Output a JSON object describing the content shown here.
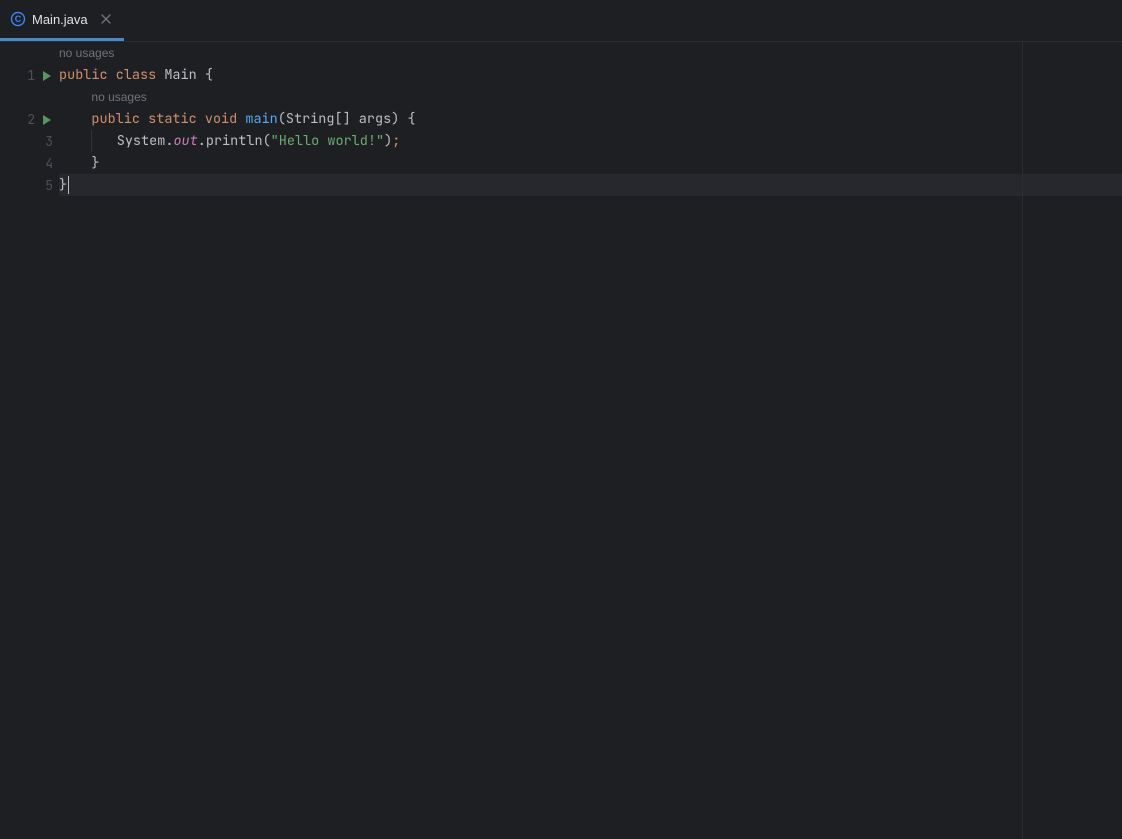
{
  "tab": {
    "filename": "Main.java",
    "icon": "java-class-icon"
  },
  "gutter": {
    "lines": [
      "1",
      "2",
      "3",
      "4",
      "5"
    ],
    "run_markers_on": [
      1,
      2
    ]
  },
  "hints": {
    "no_usages": "no usages"
  },
  "code": {
    "l1": {
      "kw1": "public",
      "kw2": "class",
      "name": "Main",
      "brace": "{"
    },
    "l2": {
      "kw1": "public",
      "kw2": "static",
      "kw3": "void",
      "mname": "main",
      "lpar": "(",
      "ptype": "String",
      "brackets": "[]",
      "pname": "args",
      "rpar": ")",
      "brace": "{"
    },
    "l3": {
      "obj": "System",
      "dot1": ".",
      "field": "out",
      "dot2": ".",
      "call": "println",
      "lpar": "(",
      "str": "\"Hello world!\"",
      "rpar": ")",
      "semi": ";"
    },
    "l4": {
      "brace": "}"
    },
    "l5": {
      "brace": "}"
    }
  }
}
